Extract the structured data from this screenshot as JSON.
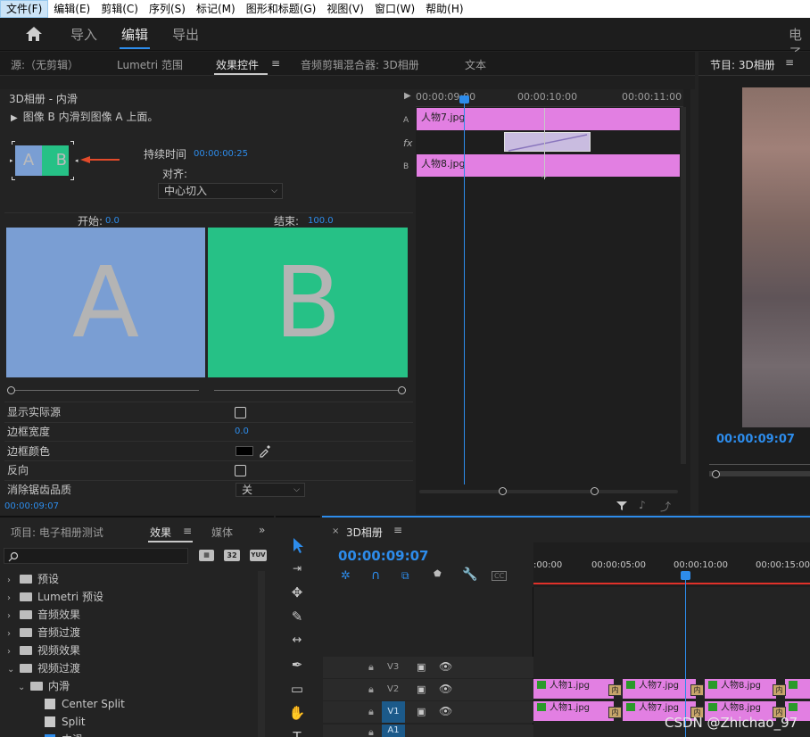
{
  "menu": [
    "文件(F)",
    "编辑(E)",
    "剪辑(C)",
    "序列(S)",
    "标记(M)",
    "图形和标题(G)",
    "视图(V)",
    "窗口(W)",
    "帮助(H)"
  ],
  "workspace": {
    "tabs": [
      "导入",
      "编辑",
      "导出"
    ],
    "active": "编辑",
    "right_title": "电子"
  },
  "source_tabs": [
    "源:（无剪辑）",
    "Lumetri 范围",
    "效果控件",
    "音频剪辑混合器: 3D相册",
    "文本"
  ],
  "program_title": "节目: 3D相册",
  "effect_controls": {
    "header": "3D相册 - 内滑",
    "description": "图像 B 内滑到图像 A 上面。",
    "duration_label": "持续时间",
    "duration_value": "00:00:00:25",
    "align_label": "对齐:",
    "align_value": "中心切入",
    "start_label": "开始:",
    "start_value": "0.0",
    "end_label": "结束:",
    "end_value": "100.0",
    "preview_a": "A",
    "preview_b": "B",
    "thumb_a": "A",
    "thumb_b": "B",
    "props": [
      {
        "label": "显示实际源"
      },
      {
        "label": "边框宽度",
        "value": "0.0"
      },
      {
        "label": "边框颜色"
      },
      {
        "label": "反向"
      },
      {
        "label": "消除锯齿品质",
        "value": "关"
      }
    ],
    "timecode": "00:00:09:07",
    "mini_ruler": [
      "00:00:09:00",
      "00:00:10:00",
      "00:00:11:00"
    ],
    "track_a_label": "A",
    "track_b_label": "B",
    "fx_label": "fx",
    "clip_a": "人物7.jpg",
    "clip_b": "人物8.jpg"
  },
  "program": {
    "timecode": "00:00:09:07"
  },
  "project": {
    "tabs": [
      "项目: 电子相册测试",
      "效果",
      "媒体"
    ],
    "active_tab": "效果",
    "badges": [
      "32",
      "YUV"
    ],
    "tree": [
      {
        "label": "预设",
        "level": 0,
        "open": false
      },
      {
        "label": "Lumetri 预设",
        "level": 0,
        "open": false
      },
      {
        "label": "音频效果",
        "level": 0,
        "open": false
      },
      {
        "label": "音频过渡",
        "level": 0,
        "open": false
      },
      {
        "label": "视频效果",
        "level": 0,
        "open": false
      },
      {
        "label": "视频过渡",
        "level": 0,
        "open": true
      },
      {
        "label": "内滑",
        "level": 1,
        "open": true
      },
      {
        "label": "Center Split",
        "level": 2
      },
      {
        "label": "Split",
        "level": 2
      },
      {
        "label": "内滑",
        "level": 2
      }
    ]
  },
  "timeline": {
    "title": "3D相册",
    "timecode": "00:00:09:07",
    "ruler": [
      ":00:00",
      "00:00:05:00",
      "00:00:10:00",
      "00:00:15:00"
    ],
    "tracks": [
      "V3",
      "V2",
      "V1",
      "A1"
    ],
    "v2_clips": [
      "人物1.jpg",
      "人物7.jpg",
      "人物8.jpg"
    ],
    "v1_clips": [
      "人物1.jpg",
      "人物7.jpg",
      "人物8.jpg"
    ],
    "transition_label": "内"
  },
  "watermark": "CSDN @Zhichao_97",
  "colors": {
    "accent": "#2d8ceb",
    "clip": "#e27fe2",
    "preview_a": "#7a9ed3",
    "preview_b": "#26c186",
    "playhead_red": "#e0312a"
  }
}
